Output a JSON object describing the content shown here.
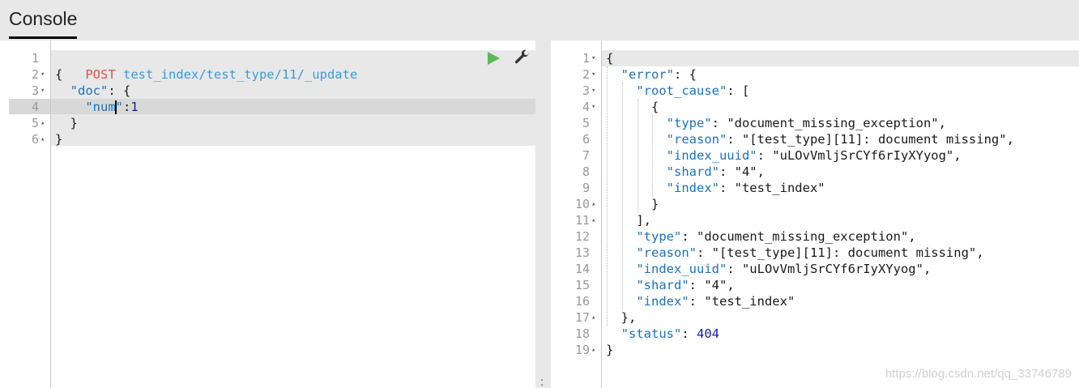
{
  "app": {
    "tab_label": "Console"
  },
  "editor": {
    "lines": [
      {
        "n": "1",
        "fold": ""
      },
      {
        "n": "2",
        "fold": "▾"
      },
      {
        "n": "3",
        "fold": "▾"
      },
      {
        "n": "4",
        "fold": ""
      },
      {
        "n": "5",
        "fold": "▴"
      },
      {
        "n": "6",
        "fold": "▴"
      }
    ],
    "method": "POST",
    "url": "test_index/test_type/11/_update",
    "l2": "{",
    "l3_key": "\"doc\"",
    "l3_rest": ": {",
    "l4_key_a": "\"num",
    "l4_key_b": "\"",
    "l4_colon": ":",
    "l4_val": "1",
    "l5": "}",
    "l6": "}"
  },
  "response": {
    "lines": [
      {
        "n": "1",
        "fold": "▾"
      },
      {
        "n": "2",
        "fold": "▾"
      },
      {
        "n": "3",
        "fold": "▾"
      },
      {
        "n": "4",
        "fold": "▾"
      },
      {
        "n": "5",
        "fold": ""
      },
      {
        "n": "6",
        "fold": ""
      },
      {
        "n": "7",
        "fold": ""
      },
      {
        "n": "8",
        "fold": ""
      },
      {
        "n": "9",
        "fold": ""
      },
      {
        "n": "10",
        "fold": "▴"
      },
      {
        "n": "11",
        "fold": "▴"
      },
      {
        "n": "12",
        "fold": ""
      },
      {
        "n": "13",
        "fold": ""
      },
      {
        "n": "14",
        "fold": ""
      },
      {
        "n": "15",
        "fold": ""
      },
      {
        "n": "16",
        "fold": ""
      },
      {
        "n": "17",
        "fold": "▴"
      },
      {
        "n": "18",
        "fold": ""
      },
      {
        "n": "19",
        "fold": "▴"
      }
    ],
    "text": [
      {
        "indent": 0,
        "key": "",
        "rest": "{"
      },
      {
        "indent": 1,
        "key": "\"error\"",
        "rest": ": {"
      },
      {
        "indent": 2,
        "key": "\"root_cause\"",
        "rest": ": ["
      },
      {
        "indent": 3,
        "key": "",
        "rest": "{"
      },
      {
        "indent": 4,
        "key": "\"type\"",
        "rest": ": \"document_missing_exception\","
      },
      {
        "indent": 4,
        "key": "\"reason\"",
        "rest": ": \"[test_type][11]: document missing\","
      },
      {
        "indent": 4,
        "key": "\"index_uuid\"",
        "rest": ": \"uLOvVmljSrCYf6rIyXYyog\","
      },
      {
        "indent": 4,
        "key": "\"shard\"",
        "rest": ": \"4\","
      },
      {
        "indent": 4,
        "key": "\"index\"",
        "rest": ": \"test_index\""
      },
      {
        "indent": 3,
        "key": "",
        "rest": "}"
      },
      {
        "indent": 2,
        "key": "",
        "rest": "],"
      },
      {
        "indent": 2,
        "key": "\"type\"",
        "rest": ": \"document_missing_exception\","
      },
      {
        "indent": 2,
        "key": "\"reason\"",
        "rest": ": \"[test_type][11]: document missing\","
      },
      {
        "indent": 2,
        "key": "\"index_uuid\"",
        "rest": ": \"uLOvVmljSrCYf6rIyXYyog\","
      },
      {
        "indent": 2,
        "key": "\"shard\"",
        "rest": ": \"4\","
      },
      {
        "indent": 2,
        "key": "\"index\"",
        "rest": ": \"test_index\""
      },
      {
        "indent": 1,
        "key": "",
        "rest": "},"
      },
      {
        "indent": 1,
        "key": "\"status\"",
        "rest": ": ",
        "num": "404"
      },
      {
        "indent": 0,
        "key": "",
        "rest": "}"
      }
    ]
  },
  "icons": {
    "run": "play-icon",
    "settings": "wrench-icon",
    "resize": "resize-handle-icon"
  },
  "colors": {
    "method": "#d9534f",
    "url": "#3d9ad1",
    "key": "#1b72b8",
    "run": "#5cb85c",
    "number": "#1a1aa6"
  },
  "divider": {
    "handle": ":"
  },
  "watermark": "https://blog.csdn.net/qq_33746789"
}
